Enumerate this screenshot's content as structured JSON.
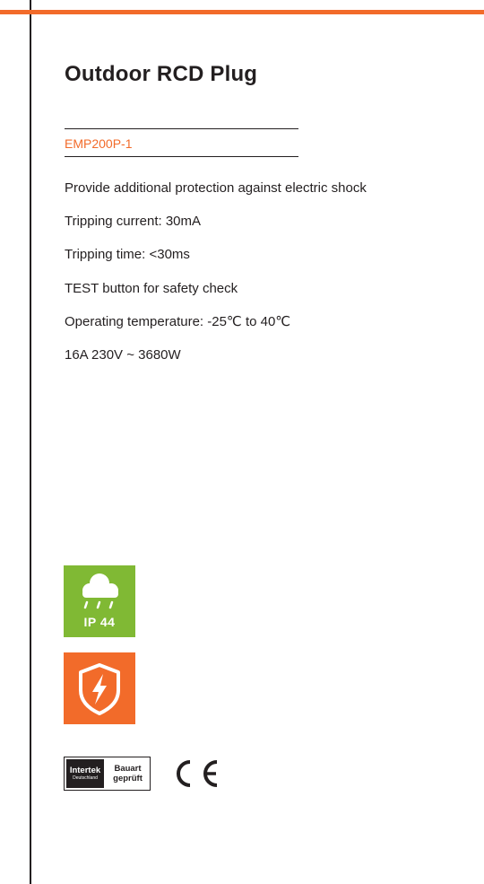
{
  "title": "Outdoor RCD Plug",
  "model": "EMP200P-1",
  "specs": [
    "Provide additional protection against electric shock",
    "Tripping current: 30mA",
    "Tripping time: <30ms",
    "TEST button for safety check",
    "Operating temperature: -25℃ to 40℃",
    "16A 230V ~ 3680W"
  ],
  "badges": {
    "ip_rating": "IP 44",
    "ip_icon": "rain-cloud-icon",
    "shock_icon": "shield-lightning-icon"
  },
  "certifications": {
    "intertek_brand": "Intertek",
    "intertek_sub": "Deutschland",
    "bauart_line1": "Bauart",
    "bauart_line2": "geprüft",
    "ce_icon": "ce-mark-icon"
  },
  "colors": {
    "accent": "#f26b2a",
    "ip_green": "#80b934",
    "text": "#231f20"
  }
}
